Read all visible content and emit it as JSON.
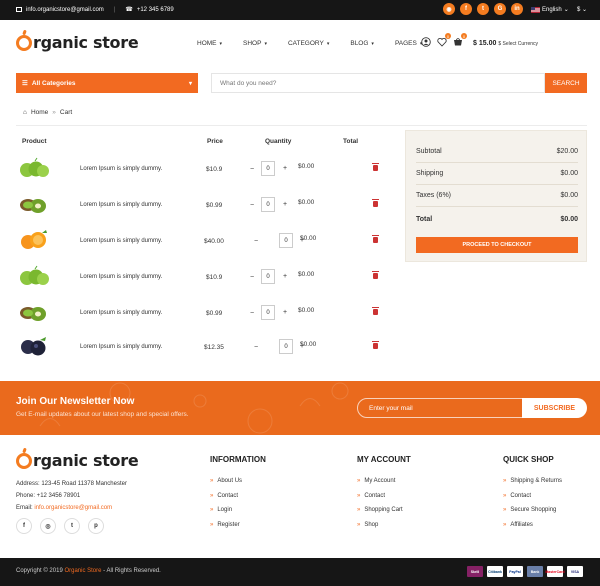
{
  "topbar": {
    "email": "info.organicstore@gmail.com",
    "phone": "+12 345 6789",
    "social_icons": [
      "rss-icon",
      "facebook-icon",
      "twitter-icon",
      "google-plus-icon",
      "linkedin-icon"
    ],
    "language": "English",
    "currency": "$"
  },
  "header": {
    "logo_text": "rganic store",
    "nav": [
      "HOME",
      "SHOP",
      "CATEGORY",
      "BLOG",
      "PAGES"
    ],
    "cart_price": "$ 15.00",
    "cart_sub": "$ Select Currency",
    "wish_badge": "0",
    "cart_badge": "0"
  },
  "search": {
    "categories_label": "All Categories",
    "placeholder": "What do you need?",
    "button": "SEARCH"
  },
  "breadcrumb": {
    "home": "Home",
    "current": "Cart"
  },
  "cart": {
    "headers": {
      "product": "Product",
      "price": "Price",
      "quantity": "Quantity",
      "total": "Total"
    },
    "rows": [
      {
        "desc": "Lorem Ipsum is simply dummy.",
        "price": "$10.9",
        "qty": "0",
        "total": "$0.00",
        "fruit": "apple"
      },
      {
        "desc": "Lorem Ipsum is simply dummy.",
        "price": "$0.99",
        "qty": "0",
        "total": "$0.00",
        "fruit": "kiwi"
      },
      {
        "desc": "Lorem Ipsum is simply dummy.",
        "price": "$40.00",
        "qty": "0",
        "total": "$0.00",
        "fruit": "orange"
      },
      {
        "desc": "Lorem Ipsum is simply dummy.",
        "price": "$10.9",
        "qty": "0",
        "total": "$0.00",
        "fruit": "apple"
      },
      {
        "desc": "Lorem Ipsum is simply dummy.",
        "price": "$0.99",
        "qty": "0",
        "total": "$0.00",
        "fruit": "kiwi"
      },
      {
        "desc": "Lorem Ipsum is simply dummy.",
        "price": "$12.35",
        "qty": "0",
        "total": "$0.00",
        "fruit": "plum"
      }
    ]
  },
  "summary": {
    "subtotal_label": "Subtotal",
    "subtotal": "$20.00",
    "shipping_label": "Shipping",
    "shipping": "$0.00",
    "taxes_label": "Taxes (6%)",
    "taxes": "$0.00",
    "total_label": "Total",
    "total": "$0.00",
    "checkout": "PROCEED TO CHECKOUT"
  },
  "newsletter": {
    "title": "Join Our Newsletter Now",
    "text": "Get E-mail updates about our latest shop and special offers.",
    "placeholder": "Enter your mail",
    "button": "SUBSCRIBE"
  },
  "footer": {
    "address": "Address: 123-45 Road 11378 Manchester",
    "phone": "Phone: +12 3456 78901",
    "email_label": "Email:",
    "email": "info.organicstore@gmail.com",
    "info_title": "INFORMATION",
    "info_links": [
      "About Us",
      "Contact",
      "Login",
      "Register"
    ],
    "account_title": "MY ACCOUNT",
    "account_links": [
      "My Account",
      "Contact",
      "Shopping Cart",
      "Shop"
    ],
    "quick_title": "QUICK SHOP",
    "quick_links": [
      "Shipping & Returns",
      "Contact",
      "Secure Shopping",
      "Affiliates"
    ],
    "social_icons": [
      "facebook-icon",
      "instagram-icon",
      "twitter-icon",
      "pinterest-icon"
    ]
  },
  "bottombar": {
    "copy_prefix": "Copyright © 2019",
    "brand": "Organic Store",
    "copy_suffix": "- All Rights Reserved.",
    "payments": [
      "Skrill",
      "Citibank",
      "PayPal",
      "Bank",
      "MasterCard",
      "VISA"
    ]
  },
  "colors": {
    "accent": "#f26a21",
    "dark": "#161616",
    "summary_bg": "#f5f2ec"
  }
}
